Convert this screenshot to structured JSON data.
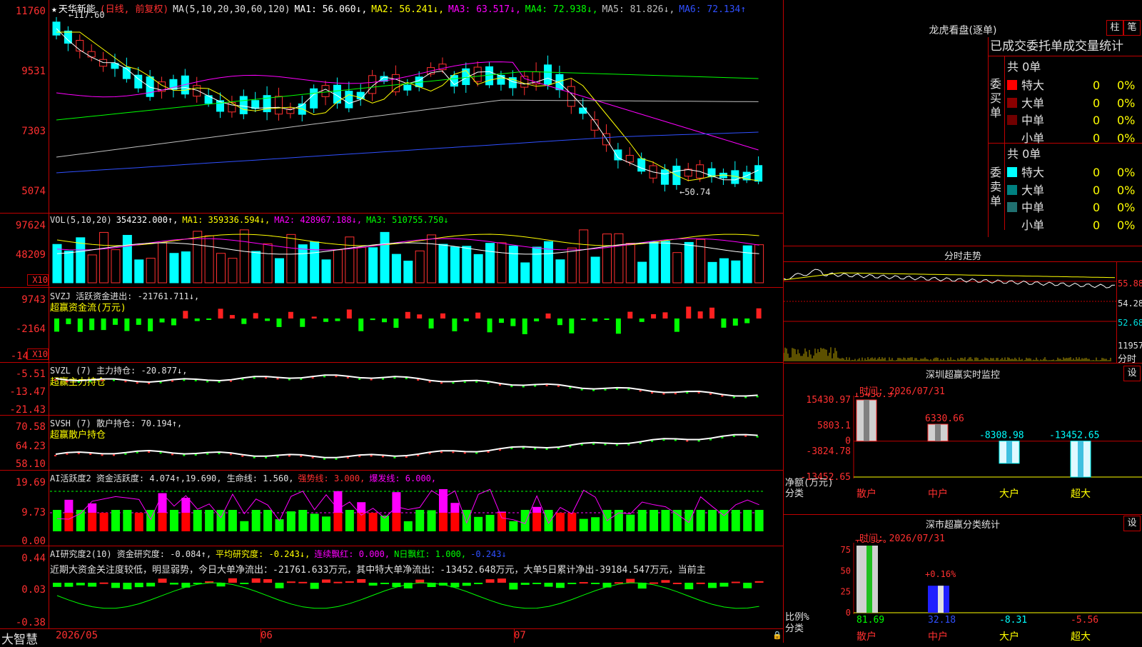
{
  "header": {
    "star": "★",
    "stock_name": "天华新能",
    "period": "(日线, 前复权)",
    "ma_label": "MA(5,10,20,30,60,120)",
    "ma1": "MA1: 56.060↓,",
    "ma2": "MA2: 56.241↓,",
    "ma3": "MA3: 63.517↓,",
    "ma4": "MA4: 72.938↓,",
    "ma5": "MA5: 81.826↓,",
    "ma6": "MA6: 72.134↑",
    "high_marker": "←117.60",
    "low_marker": "←50.74"
  },
  "price_axis": [
    "11760",
    "9531",
    "7303",
    "5074"
  ],
  "vol": {
    "title": "VOL(5,10,20)",
    "value": "354232.000↑,",
    "ma1": "MA1: 359336.594↓,",
    "ma2": "MA2: 428967.188↓,",
    "ma3": "MA3: 510755.750↓",
    "axis": [
      "97624",
      "48209"
    ],
    "unit": "X10"
  },
  "svzj": {
    "title": "SVZJ  活跃资金进出: -21761.711↓,",
    "subtitle": "超赢资金流(万元)",
    "axis": [
      "9743",
      "-2164",
      "-14"
    ],
    "unit": "X10"
  },
  "svzl": {
    "title": "SVZL (7) 主力持仓: -20.877↓,",
    "subtitle": "超赢主力持仓",
    "axis": [
      "-5.51",
      "-13.47",
      "-21.43"
    ]
  },
  "svsh": {
    "title": "SVSH (7) 散户持仓: 70.194↑,",
    "subtitle": "超赢散户持仓",
    "axis": [
      "70.58",
      "64.23",
      "58.10"
    ]
  },
  "ai_active": {
    "title": "AI活跃度2 资金活跃度: 4.074↑,19.690, 生命线: 1.560,",
    "strong": "强势线: 3.000,",
    "burst": "爆发线: 6.000,",
    "axis": [
      "19.69",
      "9.73",
      "0.00"
    ]
  },
  "ai_research": {
    "title": "AI研究度2(10) 资金研究度: -0.084↑,",
    "avg": "平均研究度: -0.243↓,",
    "cont": "连续飘红: 0.000,",
    "nday": "N日飘红: 1.000,",
    "last": "-0.243↓",
    "note": "近期大资金关注度较低，明显弱势，今日大单净流出：-21761.633万元，其中特大单净流出：-13452.648万元，大单5日累计净出-39184.547万元，当前主",
    "axis": [
      "0.44",
      "0.03",
      "-0.38"
    ]
  },
  "date_axis": {
    "brand": "大智慧",
    "labels": [
      "2026/05",
      "06",
      "07"
    ]
  },
  "dragon_tiger": {
    "title": "龙虎看盘(逐单)",
    "btn1": "柱",
    "btn2": "笔",
    "subtitle": "已成交委托单成交量统计",
    "buy_label": "委买单",
    "sell_label": "委卖单",
    "buy_total": "共 0单",
    "sell_total": "共 0单",
    "rows": [
      "特大",
      "大单",
      "中单",
      "小单"
    ],
    "count": "0",
    "pct": "0%"
  },
  "intraday": {
    "title": "分时走势",
    "axis": [
      "55.88",
      "54.28",
      "52.68",
      "11957"
    ],
    "time_label": "分时"
  },
  "sz_monitor": {
    "title": "深圳超赢实时监控",
    "btn": "设",
    "time": "时间: 2026/07/31",
    "values": [
      "15430.97",
      "6330.66",
      "-8308.98",
      "-13452.65"
    ],
    "axis": [
      "15430.97",
      "5803.1",
      "0",
      "-3824.78",
      "-13452.65"
    ],
    "ylabel": "净额(万元)",
    "xlabel": "分类",
    "cats": [
      "散户",
      "中户",
      "大户",
      "超大"
    ],
    "chart_data": {
      "type": "bar",
      "categories": [
        "散户",
        "中户",
        "大户",
        "超大"
      ],
      "values": [
        15430.97,
        6330.66,
        -8308.98,
        -13452.65
      ],
      "ylabel": "净额(万元)",
      "ylim": [
        -13452.65,
        15430.97
      ]
    }
  },
  "sz_stats": {
    "title": "深市超赢分类统计",
    "btn": "设",
    "time": "时间: 2026/07/31",
    "top_labels": [
      "+0.39%",
      "+0.16%"
    ],
    "bottom_values": [
      "81.69",
      "32.18",
      "-8.31",
      "-5.56"
    ],
    "axis": [
      "75",
      "50",
      "25",
      "0"
    ],
    "ylabel": "比例%",
    "xlabel": "分类",
    "cats": [
      "散户",
      "中户",
      "大户",
      "超大"
    ],
    "chart_data": {
      "type": "bar",
      "categories": [
        "散户",
        "中户",
        "大户",
        "超大"
      ],
      "values": [
        81.69,
        32.18,
        -8.31,
        -5.56
      ],
      "ylabel": "比例%",
      "ylim": [
        0,
        80
      ]
    }
  }
}
